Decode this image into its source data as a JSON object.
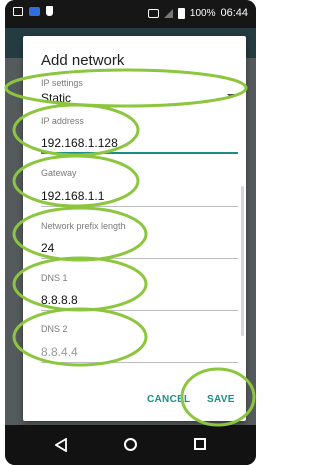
{
  "status_bar": {
    "battery": "100%",
    "time": "06:44"
  },
  "dialog": {
    "title": "Add network",
    "ip_settings": {
      "label": "IP settings",
      "value": "Static"
    },
    "ip_address": {
      "label": "IP address",
      "value": "192.168.1.128"
    },
    "gateway": {
      "label": "Gateway",
      "value": "192.168.1.1"
    },
    "prefix_length": {
      "label": "Network prefix length",
      "value": "24"
    },
    "dns1": {
      "label": "DNS 1",
      "value": "8.8.8.8"
    },
    "dns2": {
      "label": "DNS 2",
      "placeholder": "8.8.4.4"
    },
    "cancel_label": "CANCEL",
    "save_label": "SAVE"
  },
  "annotation": {
    "color": "#8cc63f"
  },
  "colors": {
    "accent": "#1a8f86"
  }
}
